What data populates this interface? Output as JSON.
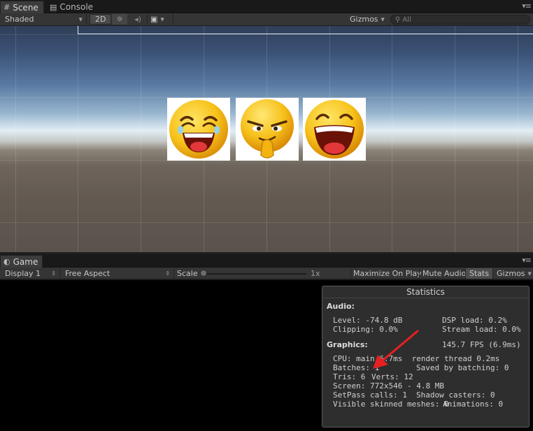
{
  "scene_tabs": [
    {
      "label": "Scene",
      "icon": "scene-icon"
    },
    {
      "label": "Console",
      "icon": "console-icon"
    }
  ],
  "scene_toolbar": {
    "shading_mode": "Shaded",
    "mode_2d": "2D",
    "gizmos": "Gizmos",
    "search_placeholder": "All"
  },
  "game_tab": {
    "label": "Game",
    "icon": "game-icon"
  },
  "game_toolbar": {
    "display": "Display 1",
    "aspect": "Free Aspect",
    "scale_label": "Scale",
    "scale_value": "1x",
    "maximize_on_play": "Maximize On Play",
    "mute_audio": "Mute Audio",
    "stats": "Stats",
    "gizmos": "Gizmos"
  },
  "statistics": {
    "title": "Statistics",
    "audio_header": "Audio:",
    "level": "Level: -74.8 dB",
    "dsp_load": "DSP load: 0.2%",
    "clipping": "Clipping: 0.0%",
    "stream_load": "Stream load: 0.0%",
    "graphics_header": "Graphics:",
    "fps": "145.7 FPS (6.9ms)",
    "cpu": "CPU: main 6.7ms  render thread 0.2ms",
    "batches": "Batches: 1",
    "saved_by_batching": "Saved by batching: 0",
    "tris": "Tris: 6",
    "verts": "Verts: 12",
    "screen": "Screen: 772x546 - 4.8 MB",
    "setpass": "SetPass calls: 1",
    "shadow_casters": "Shadow casters: 0",
    "skinned_meshes": "Visible skinned meshes: 0",
    "animations": "Animations: 0"
  },
  "emoji_sprites": [
    "laughing-emoji",
    "smirking-emoji",
    "laughing-emoji"
  ],
  "colors": {
    "annotation_arrow": "#e62020",
    "emoji_yellow": "#f7c21a"
  }
}
